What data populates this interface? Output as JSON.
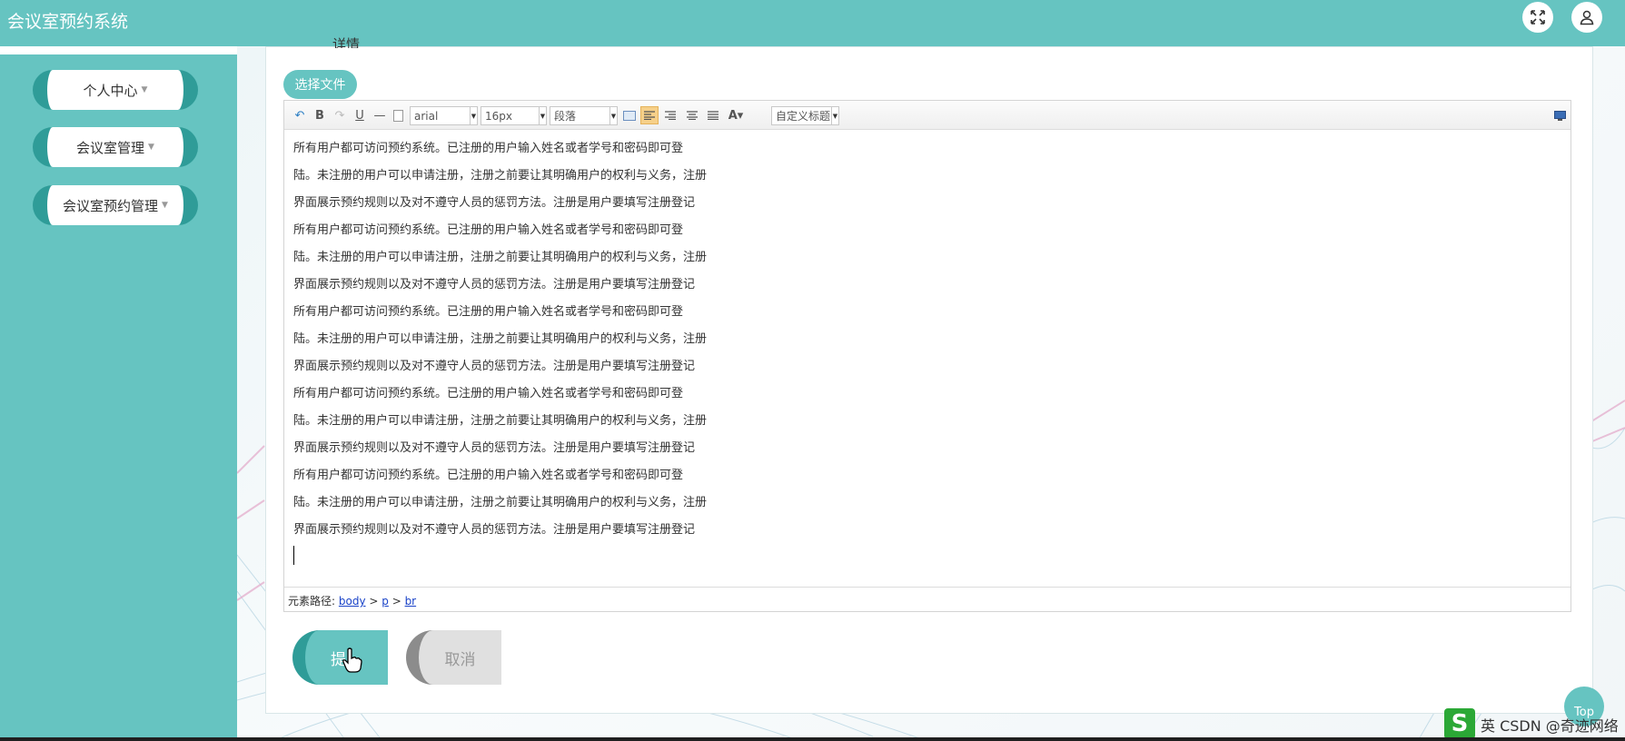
{
  "app": {
    "title": "会议室预约系统"
  },
  "sidebar": {
    "items": [
      {
        "label": "个人中心"
      },
      {
        "label": "会议室管理"
      },
      {
        "label": "会议室预约管理"
      }
    ]
  },
  "form": {
    "partial_label": "详情",
    "choose_file_label": "选择文件",
    "submit_label": "提",
    "cancel_label": "取消"
  },
  "editor": {
    "font_family": "arial",
    "font_size": "16px",
    "paragraph": "段落",
    "custom_title": "自定义标题",
    "lines": [
      "所有用户都可访问预约系统。已注册的用户输入姓名或者学号和密码即可登",
      "陆。未注册的用户可以申请注册，注册之前要让其明确用户的权利与义务，注册",
      "界面展示预约规则以及对不遵守人员的惩罚方法。注册是用户要填写注册登记",
      "所有用户都可访问预约系统。已注册的用户输入姓名或者学号和密码即可登",
      "陆。未注册的用户可以申请注册，注册之前要让其明确用户的权利与义务，注册",
      "界面展示预约规则以及对不遵守人员的惩罚方法。注册是用户要填写注册登记",
      "所有用户都可访问预约系统。已注册的用户输入姓名或者学号和密码即可登",
      "陆。未注册的用户可以申请注册，注册之前要让其明确用户的权利与义务，注册",
      "界面展示预约规则以及对不遵守人员的惩罚方法。注册是用户要填写注册登记",
      "所有用户都可访问预约系统。已注册的用户输入姓名或者学号和密码即可登",
      "陆。未注册的用户可以申请注册，注册之前要让其明确用户的权利与义务，注册",
      "界面展示预约规则以及对不遵守人员的惩罚方法。注册是用户要填写注册登记",
      "所有用户都可访问预约系统。已注册的用户输入姓名或者学号和密码即可登",
      "陆。未注册的用户可以申请注册，注册之前要让其明确用户的权利与义务，注册",
      "界面展示预约规则以及对不遵守人员的惩罚方法。注册是用户要填写注册登记"
    ],
    "path_label": "元素路径:",
    "path": [
      "body",
      "p",
      "br"
    ]
  },
  "misc": {
    "top_label": "Top",
    "watermark": "英 CSDN @奇迹网络",
    "ime_icon": "S"
  },
  "colors": {
    "primary": "#66c4c1",
    "primary_dark": "#2f9c98"
  }
}
